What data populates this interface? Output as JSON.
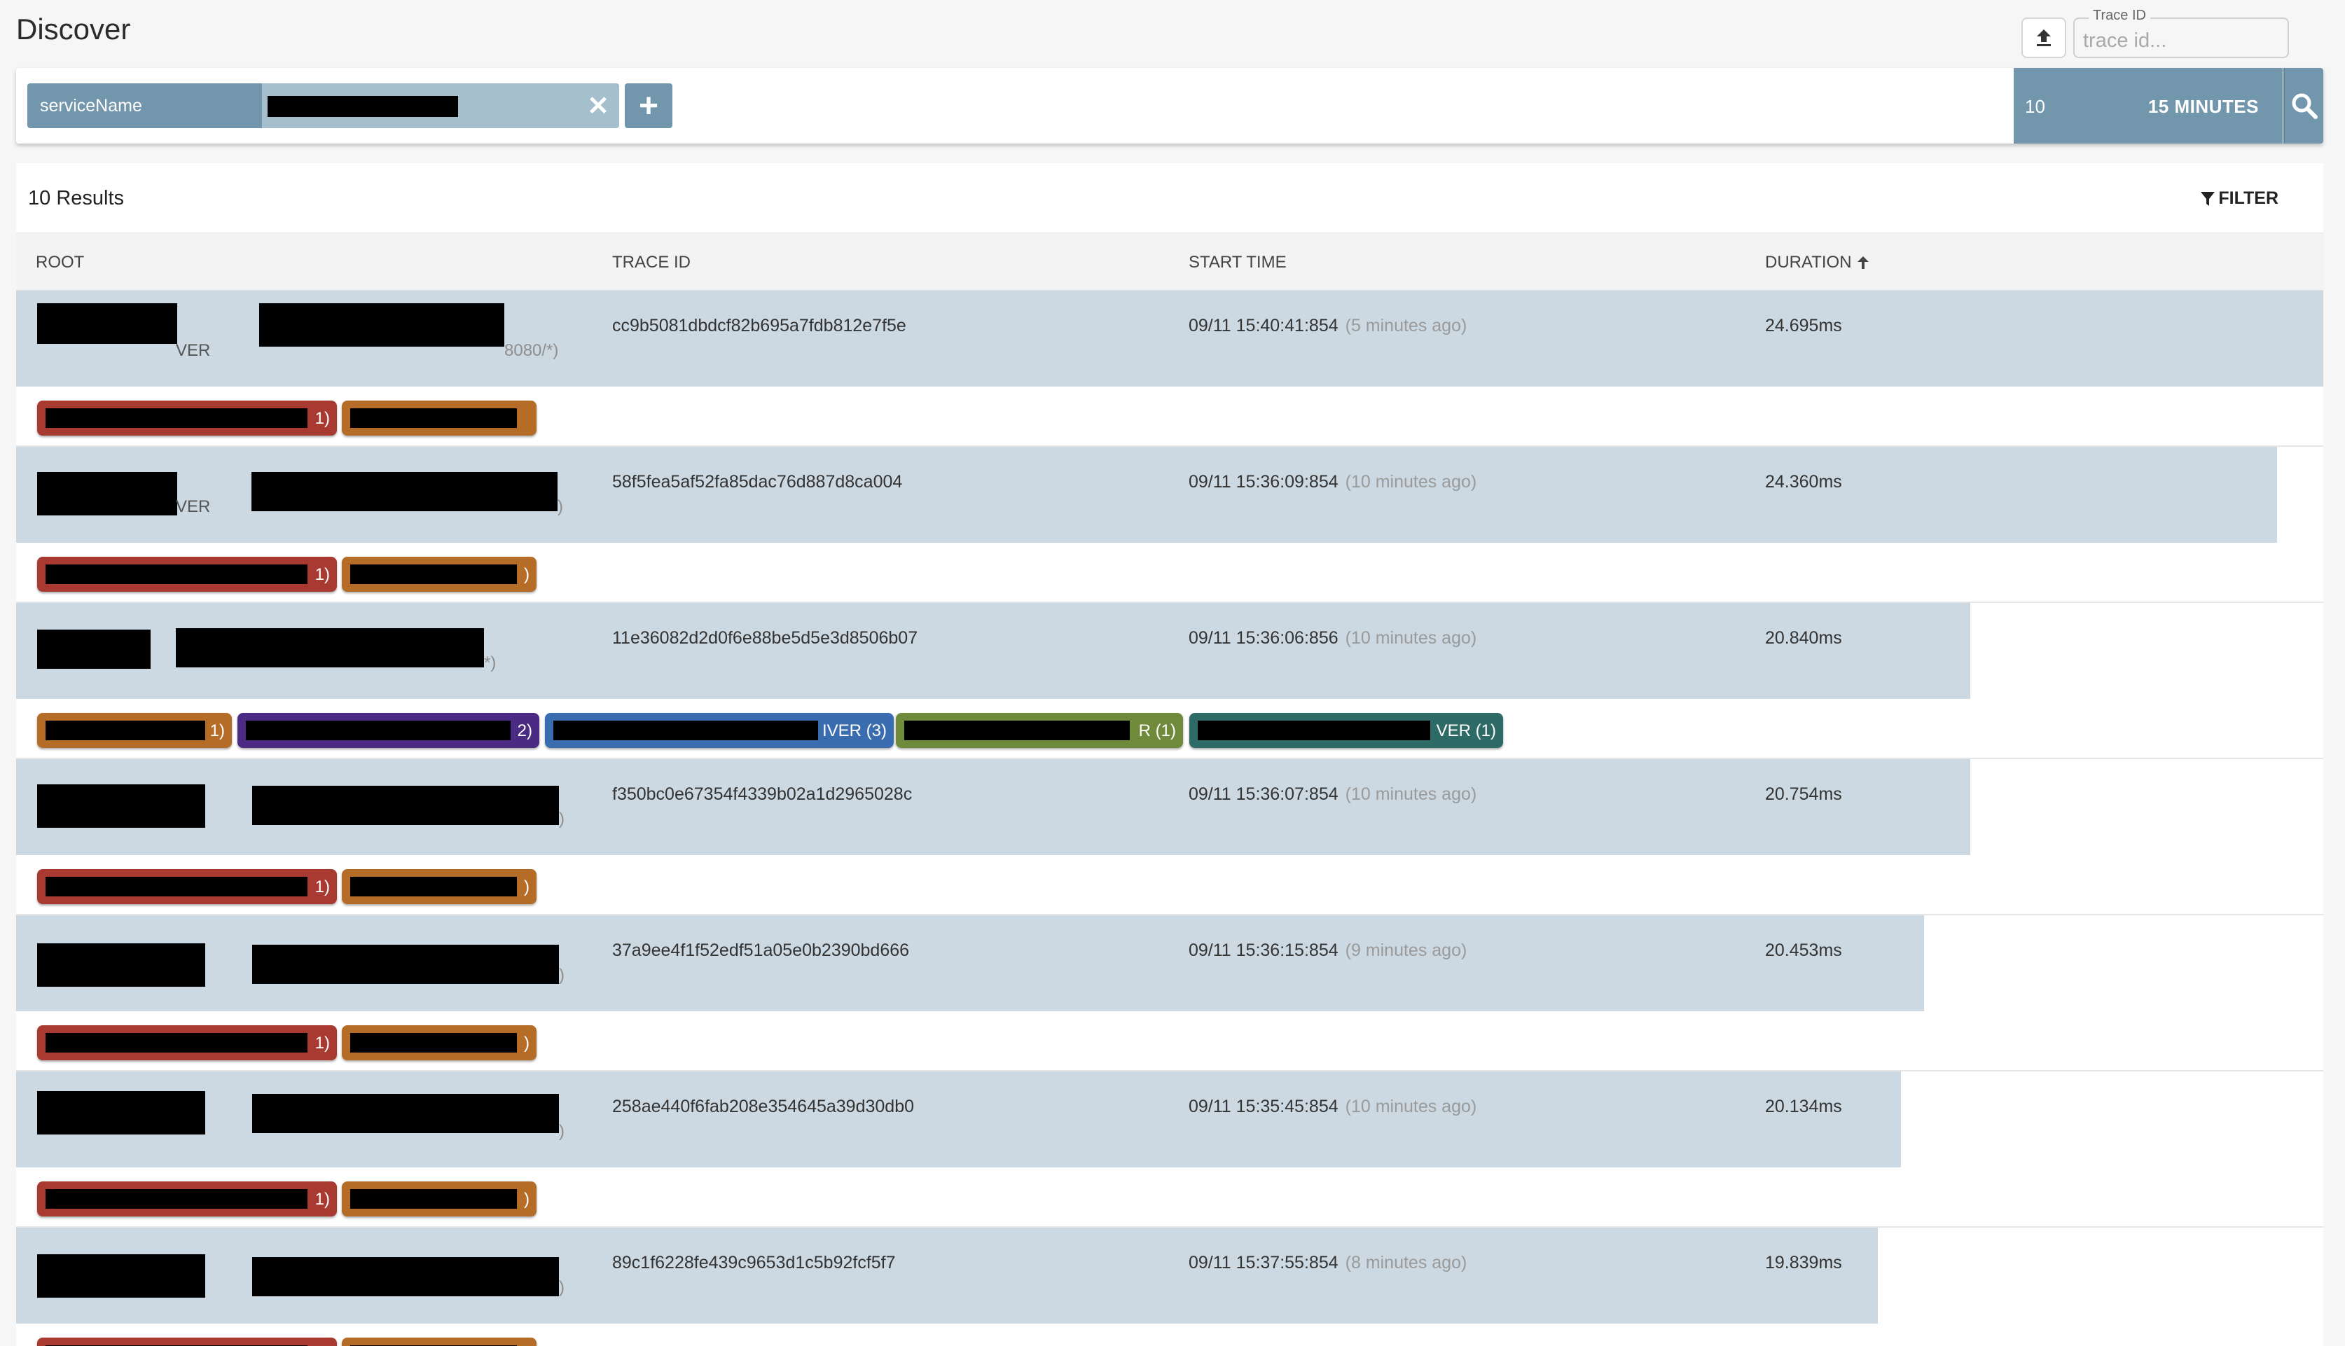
{
  "page": {
    "title": "Discover"
  },
  "trace_lookup": {
    "label": "Trace ID",
    "placeholder": "trace id..."
  },
  "search": {
    "chip_key": "serviceName",
    "limit": "10",
    "lookback": "15 MINUTES"
  },
  "results": {
    "count_label": "10 Results",
    "filter_label": "FILTER",
    "columns": {
      "root": "ROOT",
      "trace_id": "TRACE ID",
      "start_time": "START TIME",
      "duration": "DURATION"
    },
    "rows": [
      {
        "trace_id": "cc9b5081dbdcf82b695a7fdb812e7f5e",
        "start_time": "09/11 15:40:41:854",
        "ago": "(5 minutes ago)",
        "duration": "24.695ms",
        "bar_fraction": 1.0,
        "root_suffix": "VER",
        "root_tail": "8080/*)",
        "badge_texts": [
          "1)",
          ""
        ]
      },
      {
        "trace_id": "58f5fea5af52fa85dac76d887d8ca004",
        "start_time": "09/11 15:36:09:854",
        "ago": "(10 minutes ago)",
        "duration": "24.360ms",
        "bar_fraction": 0.98,
        "root_suffix": "VER",
        "root_tail": ")",
        "badge_texts": [
          "1)",
          ")"
        ]
      },
      {
        "trace_id": "11e36082d2d0f6e88be5d5e3d8506b07",
        "start_time": "09/11 15:36:06:856",
        "ago": "(10 minutes ago)",
        "duration": "20.840ms",
        "bar_fraction": 0.847,
        "root_suffix": "",
        "root_tail": "*)",
        "badge_texts": [
          "1)",
          "2)",
          "IVER (3)",
          "R (1)",
          "VER (1)"
        ]
      },
      {
        "trace_id": "f350bc0e67354f4339b02a1d2965028c",
        "start_time": "09/11 15:36:07:854",
        "ago": "(10 minutes ago)",
        "duration": "20.754ms",
        "bar_fraction": 0.847,
        "root_suffix": "",
        "root_tail": ")",
        "badge_texts": [
          "1)",
          ")"
        ]
      },
      {
        "trace_id": "37a9ee4f1f52edf51a05e0b2390bd666",
        "start_time": "09/11 15:36:15:854",
        "ago": "(9 minutes ago)",
        "duration": "20.453ms",
        "bar_fraction": 0.827,
        "root_suffix": "",
        "root_tail": ")",
        "badge_texts": [
          "1)",
          ")"
        ]
      },
      {
        "trace_id": "258ae440f6fab208e354645a39d30db0",
        "start_time": "09/11 15:35:45:854",
        "ago": "(10 minutes ago)",
        "duration": "20.134ms",
        "bar_fraction": 0.817,
        "root_suffix": "",
        "root_tail": ")",
        "badge_texts": [
          "1)",
          ")"
        ]
      },
      {
        "trace_id": "89c1f6228fe439c9653d1c5b92fcf5f7",
        "start_time": "09/11 15:37:55:854",
        "ago": "(8 minutes ago)",
        "duration": "19.839ms",
        "bar_fraction": 0.807,
        "root_suffix": "",
        "root_tail": ")",
        "badge_texts": [
          "",
          ""
        ]
      }
    ]
  },
  "colors": {
    "accent": "#7296ab",
    "row_bar": "#ccd9e2",
    "badge_red": "#a83a32",
    "badge_orange": "#b56c26",
    "badge_purple": "#4a2a82",
    "badge_blue": "#3a6db0",
    "badge_green": "#6f8a3a",
    "badge_teal": "#2e6a66"
  },
  "icons": {
    "upload": "upload-icon",
    "close": "close-icon",
    "add": "plus-icon",
    "search": "search-icon",
    "filter": "filter-icon",
    "sort": "arrow-up-icon"
  }
}
